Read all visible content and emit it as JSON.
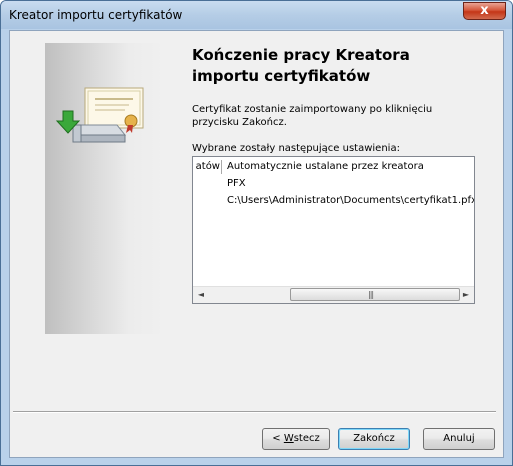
{
  "window": {
    "title": "Kreator importu certyfikatów",
    "close_glyph": "x"
  },
  "page": {
    "heading": "Kończenie pracy Kreatora importu certyfikatów",
    "info": "Certyfikat zostanie zaimportowany po kliknięciu przycisku Zakończ.",
    "settings_label": "Wybrane zostały następujące ustawienia:"
  },
  "settings": [
    {
      "name": "atów",
      "value": "Automatycznie ustalane przez kreatora"
    },
    {
      "name": "",
      "value": "PFX"
    },
    {
      "name": "",
      "value": "C:\\Users\\Administrator\\Documents\\certyfikat1.pfx"
    }
  ],
  "scrollbar": {
    "left_glyph": "◄",
    "right_glyph": "►",
    "grip_glyph": "|||"
  },
  "buttons": {
    "back_prefix": "< ",
    "back_mnemonic": "W",
    "back_rest": "stecz",
    "finish": "Zakończ",
    "cancel": "Anuluj"
  },
  "icons": {
    "wizard_art": "certificate-import-icon"
  }
}
